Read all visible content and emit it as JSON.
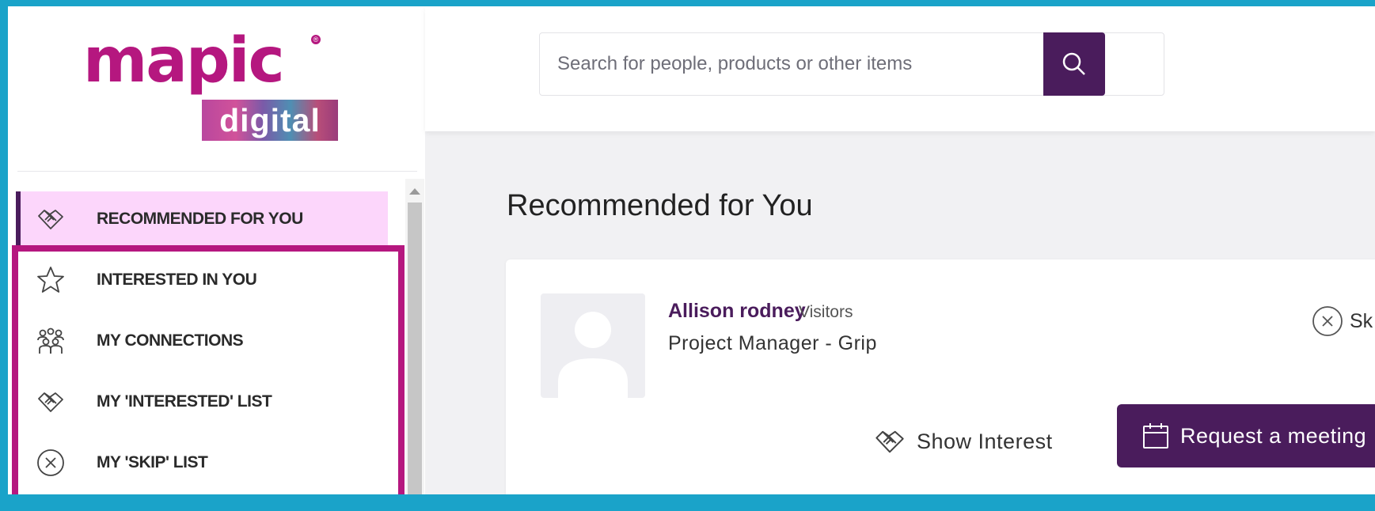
{
  "brand": {
    "logo_word": "mapic",
    "logo_sub": "digital",
    "logo_mark": "®",
    "primary_color": "#4a1c5c",
    "accent_color": "#b5177f",
    "frame_color": "#1aa3c9"
  },
  "search": {
    "placeholder": "Search for people, products or other items",
    "button_icon": "search-icon"
  },
  "sidebar": {
    "items": [
      {
        "label": "RECOMMENDED FOR YOU",
        "icon": "handshake-icon",
        "active": true
      },
      {
        "label": "INTERESTED IN YOU",
        "icon": "star-icon",
        "active": false
      },
      {
        "label": "MY CONNECTIONS",
        "icon": "people-icon",
        "active": false
      },
      {
        "label": "MY 'INTERESTED' LIST",
        "icon": "handshake-icon",
        "active": false
      },
      {
        "label": "MY 'SKIP' LIST",
        "icon": "close-circle-icon",
        "active": false
      }
    ]
  },
  "main": {
    "title": "Recommended for You",
    "card": {
      "name": "Allison rodney",
      "type": "Visitors",
      "role": "Project Manager - Grip",
      "skip_label": "Sk",
      "show_interest_label": "Show Interest",
      "request_meeting_label": "Request a meeting"
    }
  }
}
